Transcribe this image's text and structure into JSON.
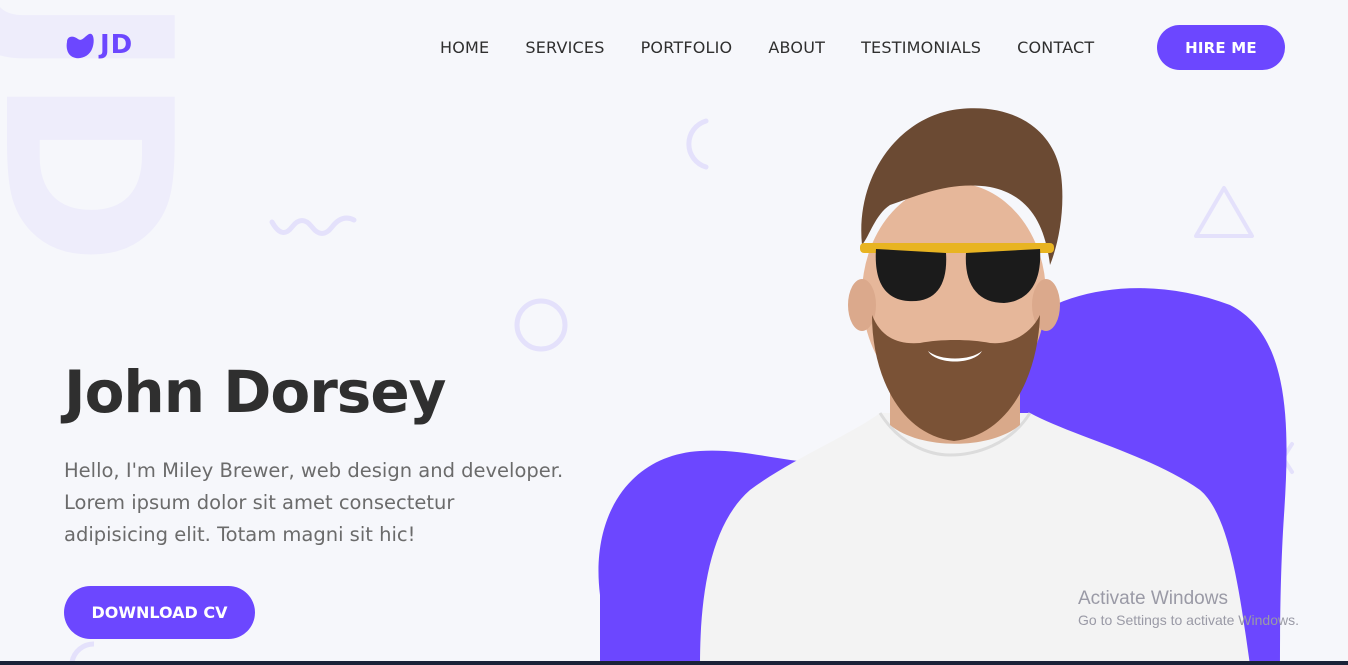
{
  "logo": {
    "text": "JD",
    "icon": "blob-logo-icon",
    "background_letters": "JD"
  },
  "nav": {
    "items": [
      "HOME",
      "SERVICES",
      "PORTFOLIO",
      "ABOUT",
      "TESTIMONIALS",
      "CONTACT"
    ],
    "cta_label": "HIRE ME"
  },
  "hero": {
    "title": "John Dorsey",
    "description": "Hello, I'm Miley Brewer, web design and developer. Lorem ipsum dolor sit amet consectetur adipisicing elit. Totam magni sit hic!",
    "button_label": "DOWNLOAD CV",
    "image": "portrait-photo-bearded-man-sunglasses"
  },
  "watermark": {
    "line1": "Activate Windows",
    "line2": "Go to Settings to activate Windows."
  },
  "colors": {
    "accent": "#6c47ff",
    "background": "#f6f7fb",
    "decor": "#e4e1fb",
    "text_dark": "#2f2f2f",
    "text_muted": "#6b6b6b"
  }
}
